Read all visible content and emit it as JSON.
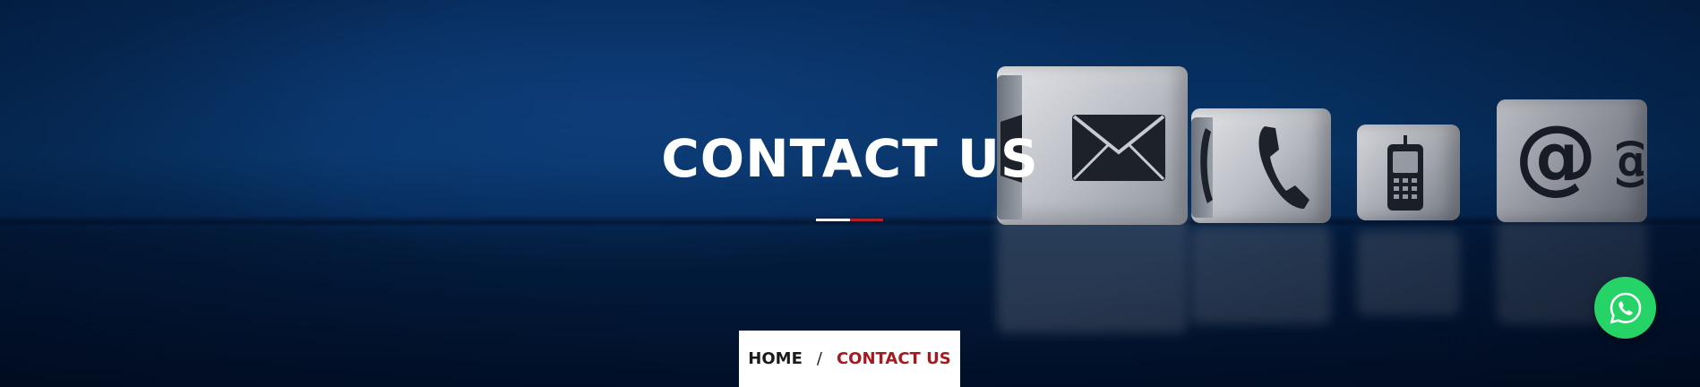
{
  "hero": {
    "title": "CONTACT US",
    "colors": {
      "background": "#062a58",
      "title": "#ffffff",
      "underline_left": "#ffffff",
      "underline_right": "#b3202a"
    },
    "decor_icons": [
      "envelope-icon",
      "phone-icon",
      "mobile-phone-icon",
      "at-sign-icon"
    ]
  },
  "breadcrumb": {
    "items": [
      {
        "label": "HOME",
        "color": "#1b1b1b"
      },
      {
        "label": "CONTACT US",
        "color": "#a8191f"
      }
    ],
    "separator": "/"
  },
  "floating": {
    "whatsapp": {
      "icon": "whatsapp-icon",
      "color": "#25d366"
    }
  }
}
